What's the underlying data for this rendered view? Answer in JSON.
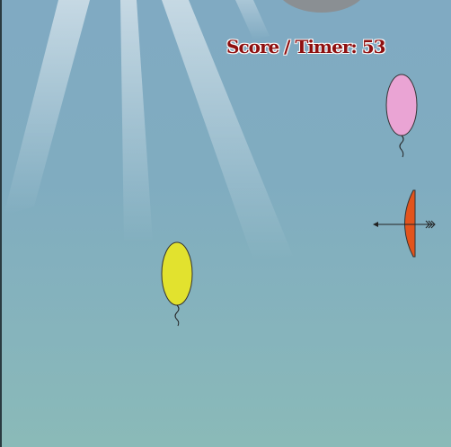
{
  "hud": {
    "score_timer_label": "Score / Timer: 53"
  },
  "colors": {
    "sky_top": "#80aac2",
    "sky_bottom": "#8abab8",
    "score_text": "#8e1010",
    "balloon_pink": "#eaa4d4",
    "balloon_yellow": "#e2e22e",
    "bow_fill": "#e2541c",
    "moon": "#8a8f93"
  },
  "game_objects": {
    "balloons": [
      {
        "color_name": "pink",
        "fill": "#eaa4d4"
      },
      {
        "color_name": "yellow",
        "fill": "#e2e22e"
      }
    ],
    "bow": {
      "icon": "bow-icon",
      "fill": "#e2541c"
    },
    "arrow": {
      "icon": "arrow-icon"
    },
    "moon": {
      "icon": "moon-icon"
    }
  }
}
